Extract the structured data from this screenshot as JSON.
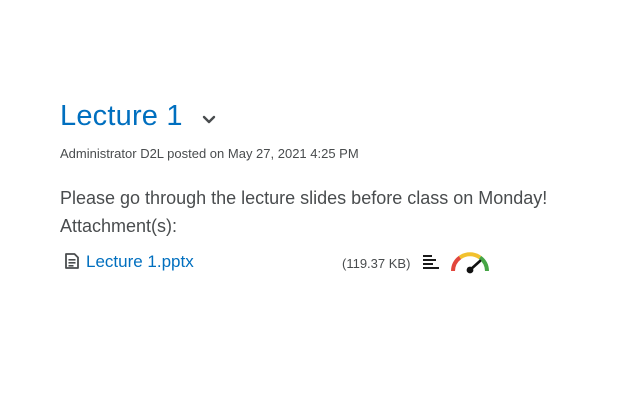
{
  "post": {
    "title": "Lecture 1",
    "author": "Administrator D2L",
    "posted_prefix": "posted on",
    "posted_date": "May 27, 2021 4:25 PM",
    "meta_text": "Administrator D2L posted on May 27, 2021 4:25 PM",
    "body": "Please go through the lecture slides before class on Monday!",
    "attachments_label": "Attachment(s):"
  },
  "attachments": [
    {
      "name": "Lecture 1.pptx",
      "size": "(119.37 KB)",
      "icons": [
        "file-icon",
        "text-lines-icon",
        "gauge-icon"
      ]
    }
  ],
  "colors": {
    "link": "#006fbf",
    "text": "#494c4e",
    "gauge_red": "#e2463c",
    "gauge_yellow": "#f2c12e",
    "gauge_green": "#46a546"
  }
}
